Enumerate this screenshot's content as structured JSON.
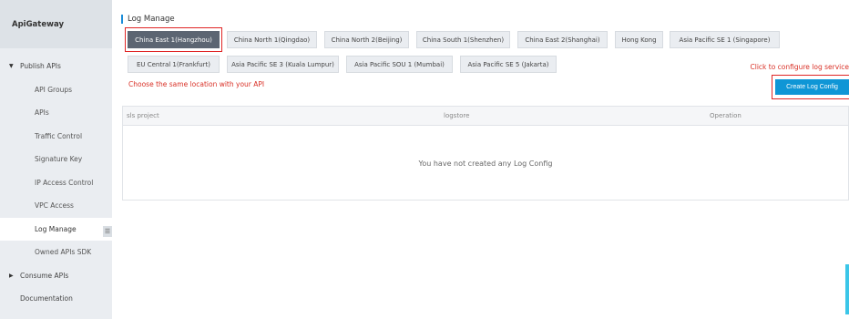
{
  "sidebar": {
    "title": "ApiGateway",
    "sections": {
      "publish": {
        "caret": "▼",
        "label": "Publish APIs"
      },
      "consume": {
        "caret": "▶",
        "label": "Consume APIs"
      }
    },
    "publish_items": [
      "API Groups",
      "APIs",
      "Traffic Control",
      "Signature Key",
      "IP Access Control",
      "VPC Access",
      "Log Manage",
      "Owned APIs SDK"
    ],
    "documentation": "Documentation",
    "active_item": "Log Manage",
    "collapse_glyph": "☰"
  },
  "page": {
    "title": "Log Manage",
    "region_tabs": [
      "China East 1(Hangzhou)",
      "China North 1(Qingdao)",
      "China North 2(Beijing)",
      "China South 1(Shenzhen)",
      "China East 2(Shanghai)",
      "Hong Kong",
      "Asia Pacific SE 1 (Singapore)",
      "EU Central 1(Frankfurt)",
      "Asia Pacific SE 3 (Kuala Lumpur)",
      "Asia Pacific SOU 1 (Mumbai)",
      "Asia Pacific SE 5 (Jakarta)"
    ],
    "selected_region": "China East 1(Hangzhou)",
    "location_hint": "Choose the same location with your API",
    "configure_hint": "Click to configure log service",
    "create_button": "Create Log Config"
  },
  "table": {
    "columns": [
      "sls project",
      "logstore",
      "Operation"
    ],
    "empty_message": "You have not created any Log Config"
  },
  "colors": {
    "accent": "#0f96d6",
    "selected_tab": "#5c6572",
    "highlight": "#e02525",
    "hint_text": "#d93026"
  }
}
